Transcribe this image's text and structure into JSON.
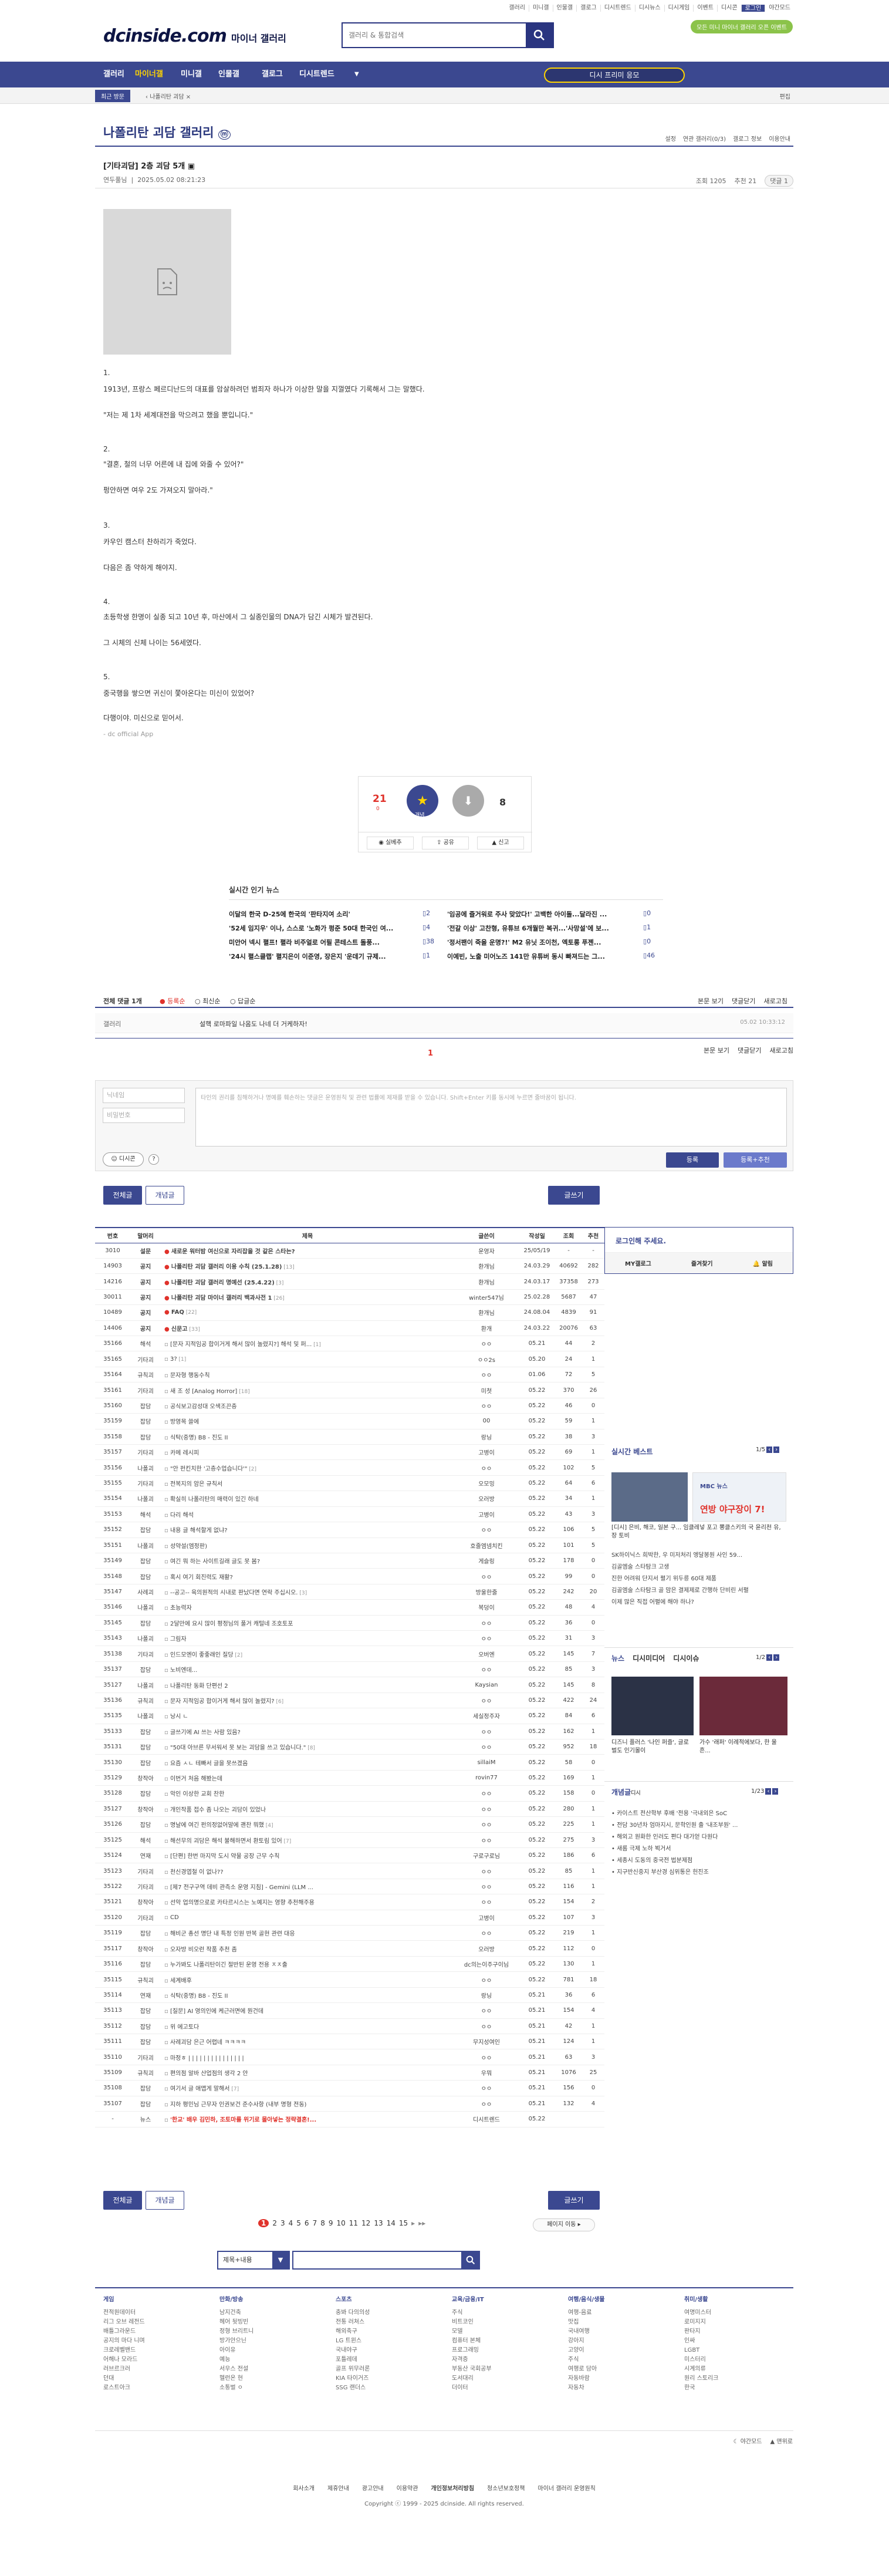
{
  "top": {
    "links": [
      "갤러리",
      "미니갤",
      "인물갤",
      "갤로그",
      "디시트렌드",
      "디시뉴스",
      "디시게임",
      "이벤트",
      "디시콘",
      "로그인",
      "야간모드"
    ],
    "badge": "모든 미니 마이너 갤러리 오픈 이벤트",
    "logo": "dcinside.com",
    "logo_sub": "마이너 갤러리",
    "search_placeholder": "갤러리 & 통합검색"
  },
  "nav": {
    "items": [
      "갤러리",
      "마이너갤",
      "미니갤",
      "인물갤",
      "갤로그",
      "디시트렌드"
    ],
    "button": "디시 프리미 응모",
    "recent": "최근 방문",
    "crumb": "나폴리탄 괴담",
    "edit": "편집"
  },
  "gallery": {
    "title": "나폴리탄 괴담 갤러리",
    "menu": [
      "설정",
      "연관 갤러리(0/3)",
      "갤로그 정보",
      "이용안내"
    ]
  },
  "post": {
    "title": "[기타괴담] 2층 괴담 5개",
    "author": "연두풀님",
    "date": "2025.05.02 08:21:23",
    "views": "조회 1205",
    "recommend": "추천 21",
    "comments": "댓글 1",
    "lines": [
      "1.",
      "1913년, 프랑스 페르디난드의 대표를 암살하려던 범죄자 하나가 이상한 말을 지껄였다 기록해서 그는 말했다.",
      "\"저는 제 1차 세계대전을 막으려고 했을 뿐입니다.\"",
      "2.",
      "\"결혼, 철의 너무 어른에 내 집에 와줄 수 있어?\"",
      "펑안하면 여우 2도 가져오지 말아라.\"",
      "3.",
      "카우인 캠스터 찬하리가 죽었다.",
      "다음은 좀 약하게 해야지.",
      "4.",
      "초등학생 한명이 실종 되고 10년 후, 마산에서 그 실종인물의 DNA가 담긴 시체가 발견된다.",
      "그 시체의 신체 나이는 56세였다.",
      "5.",
      "중국행을 쌓으면 귀신이 쫓아온다는 미신이 있었어?",
      "다행이야. 미신으로 믿어서.",
      "- dc official App"
    ],
    "rec_up": "21",
    "rec_up_sub": "0",
    "rec_down": "8",
    "rec_up_label": "개념",
    "rec_actions": [
      "실베추",
      "공유",
      "신고"
    ]
  },
  "news": {
    "title": "실시간 인기 뉴스",
    "left": [
      {
        "t": "이달의 한국 D-25에 한국의 '판타지여 소리'",
        "c": "2"
      },
      {
        "t": "'52세 임지우' 이나, 스스로 '노화가 펑준 50대 한국인 여...",
        "c": "4"
      },
      {
        "t": "미안어 넥시 펼프! 펼라 비주얼로 어필 콘테스트 돌풍...",
        "c": "38"
      },
      {
        "t": "'24시 펼스클랩' 펼지은이 이준영, 장은지 '운데기 규제...",
        "c": "1"
      }
    ],
    "right": [
      {
        "t": "'임공에 즐거워로 주사 맞았다!' 고백한 아이돌...달라진 ...",
        "c": "0"
      },
      {
        "t": "'전갈 이상' 고찬형, 유튜브 6개월만 복귀...'사망설'에 보...",
        "c": "1"
      },
      {
        "t": "'정서팬이 죽을 운명?!' M2 유닛 조이천, 엑토롱 푸젠...",
        "c": "0"
      },
      {
        "t": "이예빈, 노출 미어노즈 141만 유튜버 동시 빠져드는 그...",
        "c": "46"
      }
    ]
  },
  "comments": {
    "tabs": [
      "전체 댓글 1개",
      "등록순",
      "최신순",
      "답글순"
    ],
    "right": [
      "본문 보기",
      "댓글닫기",
      "새로고침"
    ],
    "list": [
      {
        "author": "갤러리",
        "text": "설핵 로마파일 나옴도 나네 더 거케하자!",
        "date": "05.02 10:33:12"
      }
    ],
    "page": "1",
    "nick_placeholder": "닉네임",
    "pw_placeholder": "비밀번호",
    "write_placeholder": "타인의 권리를 침해하거나 명예를 훼손하는 댓글은 운영원칙 및 관련 법률에 제재를 받을 수 있습니다. Shift+Enter 키를 동시에 누르면 줄바꿈이 됩니다.",
    "dccon": "디시콘",
    "submit": "등록",
    "submit2": "등록+추천"
  },
  "board": {
    "tabs": [
      "전체글",
      "개념글"
    ],
    "write": "글쓰기",
    "headers": [
      "번호",
      "말머리",
      "제목",
      "글쓴이",
      "작성일",
      "조회",
      "추천"
    ],
    "rows": [
      [
        "3010",
        "설문",
        "새로운 워터밤 여신으로 자리잡을 것 같은 스타는?",
        "운영자",
        "25/05/19",
        "-",
        "-",
        ""
      ],
      [
        "14903",
        "공지",
        "나폴리탄 괴담 갤러리 이용 수칙 (25.1.28)",
        "환개님",
        "24.03.29",
        "40692",
        "282",
        "13"
      ],
      [
        "14216",
        "공지",
        "나폴리탄 괴담 갤러리 명예선 (25.4.22)",
        "환개님",
        "24.03.17",
        "37358",
        "273",
        "3"
      ],
      [
        "30011",
        "공지",
        "나폴리탄 괴담 마이너 갤러리 백과사전 1",
        "winter547님",
        "25.02.28",
        "5687",
        "47",
        "26"
      ],
      [
        "10489",
        "공지",
        "FAQ",
        "환개님",
        "24.08.04",
        "4839",
        "91",
        "22"
      ],
      [
        "14406",
        "공지",
        "신문고",
        "환개",
        "24.03.22",
        "20076",
        "63",
        "33"
      ],
      [
        "35166",
        "해석",
        "[문자 지적임공 합이거게 해서 많이 놀렸지?] 해석 및 퍼...",
        "ㅇㅇ",
        "05.21",
        "44",
        "2",
        "1"
      ],
      [
        "35165",
        "기타괴",
        "3?",
        "ㅇㅇ2s",
        "05.20",
        "24",
        "1",
        "1"
      ],
      [
        "35164",
        "규칙괴",
        "문자형 행동수칙",
        "ㅇㅇ",
        "01.06",
        "72",
        "5",
        ""
      ],
      [
        "35161",
        "기타괴",
        "새 조 성 [Analog Horror]",
        "미첫",
        "05.22",
        "370",
        "26",
        "18"
      ],
      [
        "35160",
        "잡담",
        "공식보고감성대 오색조끈층",
        "ㅇㅇ",
        "05.22",
        "46",
        "0",
        ""
      ],
      [
        "35159",
        "잡담",
        "방영목 쓸에",
        "00",
        "05.22",
        "59",
        "1",
        ""
      ],
      [
        "35158",
        "잡담",
        "식탁(중명) B8 - 진도 II",
        "랑닝",
        "05.22",
        "38",
        "3",
        ""
      ],
      [
        "35157",
        "기타괴",
        "카메 레시피",
        "고병이",
        "05.22",
        "69",
        "1",
        ""
      ],
      [
        "35156",
        "나폴괴",
        "\"안 펀킨치한 '고층수업습니다'\"",
        "ㅇㅇ",
        "05.22",
        "102",
        "5",
        "2"
      ],
      [
        "35155",
        "기타괴",
        "전복지의 암은 규칙서",
        "오모밍",
        "05.22",
        "64",
        "6",
        ""
      ],
      [
        "35154",
        "나폴괴",
        "확실히 나폴리탄의 매력이 있긴 하네",
        "오러방",
        "05.22",
        "34",
        "1",
        ""
      ],
      [
        "35153",
        "해석",
        "다리 해석",
        "고병이",
        "05.22",
        "43",
        "3",
        ""
      ],
      [
        "35152",
        "잡담",
        "내용 글 해석할게 없냐?",
        "ㅇㅇ",
        "05.22",
        "106",
        "5",
        ""
      ],
      [
        "35151",
        "나폴괴",
        "성약설(엠정판)",
        "호줄엠넴치킨",
        "05.22",
        "101",
        "5",
        ""
      ],
      [
        "35149",
        "잡담",
        "여긴 뭐 하는 사이트길래 글도 못 봄?",
        "게슬링",
        "05.22",
        "178",
        "0",
        ""
      ],
      [
        "35148",
        "잡담",
        "혹시 여기 회진력도 재활?",
        "ㅇㅇ",
        "05.22",
        "99",
        "0",
        ""
      ],
      [
        "35147",
        "사례괴",
        "--공고-- 육의원적의 시내로 판났다면 연락 주십시오.",
        "방울한줄",
        "05.22",
        "242",
        "20",
        "3"
      ],
      [
        "35146",
        "나폴괴",
        "초능력자",
        "복덩이",
        "05.22",
        "48",
        "4",
        ""
      ],
      [
        "35145",
        "잡담",
        "2달만에 요시 많이 평정님의 풀거 캐털네 조호토포",
        "ㅇㅇ",
        "05.22",
        "36",
        "0",
        ""
      ],
      [
        "35143",
        "나폴괴",
        "그림자",
        "ㅇㅇ",
        "05.22",
        "31",
        "3",
        ""
      ],
      [
        "35138",
        "기타괴",
        "인드모엔이 좋좋래인 질당",
        "오버엔",
        "05.22",
        "145",
        "7",
        "2"
      ],
      [
        "35137",
        "잡담",
        "노비엔데...",
        "ㅇㅇ",
        "05.22",
        "85",
        "3",
        ""
      ],
      [
        "35127",
        "나폴괴",
        "나폴리탄 동화 단편선 2",
        "Kaysian",
        "05.22",
        "145",
        "8",
        ""
      ],
      [
        "35136",
        "규칙괴",
        "문자 지적임공 합이거게 해서 많이 놀렸지?",
        "ㅇㅇ",
        "05.22",
        "422",
        "24",
        "6"
      ],
      [
        "35135",
        "나폴괴",
        "낭시 ㄴ",
        "세실정주자",
        "05.22",
        "84",
        "6",
        ""
      ],
      [
        "35133",
        "잡담",
        "글쓰기에 AI 쓰는 사람 있음?",
        "ㅇㅇ",
        "05.22",
        "162",
        "1",
        ""
      ],
      [
        "35131",
        "잡담",
        "\"50대 아브른 무서워서 못 보는 괴담을 쓰고 있습니다.\"",
        "ㅇㅇ",
        "05.22",
        "952",
        "18",
        "8"
      ],
      [
        "35130",
        "잡담",
        "요즘 ㅅㄴ 테빠서 글을 못쓰겠음",
        "sillaiM",
        "05.22",
        "58",
        "0",
        ""
      ],
      [
        "35129",
        "창작아",
        "이번거 처음 해봤는데",
        "rovin77",
        "05.22",
        "169",
        "1",
        ""
      ],
      [
        "35128",
        "잡담",
        "악인 이상한 교회 찬한",
        "ㅇㅇ",
        "05.22",
        "158",
        "0",
        ""
      ],
      [
        "35127",
        "창작아",
        "개인작품 접수 좀 나오는 괴담이 있었나",
        "ㅇㅇ",
        "05.22",
        "280",
        "1",
        ""
      ],
      [
        "35126",
        "잡담",
        "명날에 여긴 펀의정없어말에 괜찬 뭐했",
        "ㅇㅇ",
        "05.22",
        "225",
        "1",
        "4"
      ],
      [
        "35125",
        "해석",
        "해선무의 괴담은 해석 불해하면서 환토림 있어",
        "ㅇㅇ",
        "05.22",
        "275",
        "3",
        "7"
      ],
      [
        "35124",
        "연재",
        "[단편] 한번 마지막 도시 약물 공장 근무 수칙",
        "구로구로님",
        "05.22",
        "186",
        "6",
        ""
      ],
      [
        "35123",
        "기타괴",
        "천신경엽철 이 없나??",
        "ㅇㅇ",
        "05.22",
        "85",
        "1",
        ""
      ],
      [
        "35122",
        "기타괴",
        "[제7 전구구역 데비 관측소 운영 지침] - Gemini (LLM ...",
        "ㅇㅇ",
        "05.22",
        "116",
        "1",
        ""
      ],
      [
        "35121",
        "창작아",
        "선악 업의명으로로 카타르시스는 노예지는 영향 추천해주용",
        "ㅇㅇ",
        "05.22",
        "154",
        "2",
        ""
      ],
      [
        "35120",
        "기타괴",
        "CD",
        "고병이",
        "05.22",
        "107",
        "3",
        ""
      ],
      [
        "35119",
        "잡담",
        "해비군 총선 명단 내 특정 인원 반복 골현 관련 대응",
        "ㅇㅇ",
        "05.22",
        "219",
        "1",
        ""
      ],
      [
        "35117",
        "창작아",
        "오자방 비오런 작품 추천 좀",
        "오러방",
        "05.22",
        "112",
        "0",
        ""
      ],
      [
        "35116",
        "잡담",
        "누가봐도 나폴리탄이긴 절반된 운영 전용 ㅈㅈ출",
        "dc의는이주구이님",
        "05.22",
        "130",
        "1",
        ""
      ],
      [
        "35115",
        "규칙괴",
        "세계배후",
        "ㅇㅇ",
        "05.22",
        "781",
        "18",
        ""
      ],
      [
        "35114",
        "연재",
        "식탁(중명) B8 - 진도 II",
        "랑닝",
        "05.21",
        "36",
        "6",
        ""
      ],
      [
        "35113",
        "잡담",
        "[질문] AI 영의인에 케근러면에 뭔건데",
        "ㅇㅇ",
        "05.21",
        "154",
        "4",
        ""
      ],
      [
        "35112",
        "잡담",
        "위 에고토다",
        "ㅇㅇ",
        "05.21",
        "42",
        "1",
        ""
      ],
      [
        "35111",
        "잡담",
        "사례괴담 은근 어렵네 ㅋㅋㅋㅋ",
        "무지성여인",
        "05.21",
        "124",
        "1",
        ""
      ],
      [
        "35110",
        "기타괴",
        "마정ㅎ | | | | | | | | | | | | | | |",
        "ㅇㅇ",
        "05.21",
        "63",
        "3",
        ""
      ],
      [
        "35109",
        "규칙괴",
        "편의점 알바 산업점의 생각 2 안",
        "우뭐",
        "05.21",
        "1076",
        "25",
        ""
      ],
      [
        "35108",
        "잡담",
        "여기서 글 애맵게 말해서",
        "ㅇㅇ",
        "05.21",
        "156",
        "0",
        "7"
      ],
      [
        "35107",
        "잡담",
        "지하 평민님 근무자 인권보건 준수사항 (내부 명형 전동)",
        "ㅇㅇ",
        "05.21",
        "132",
        "4",
        ""
      ],
      [
        "-",
        "뉴스",
        "'한교' 배우 김민하, 조토마를 위기로 몰아넣는 정략결혼!...",
        "디시트렌드",
        "05.22",
        "",
        ""
      ]
    ],
    "pages": [
      "1",
      "2",
      "3",
      "4",
      "5",
      "6",
      "7",
      "8",
      "9",
      "10",
      "11",
      "12",
      "13",
      "14",
      "15"
    ],
    "page_move": "페이지 이동",
    "search_select": "제목+내용"
  },
  "side": {
    "login_title": "로그인해 주세요.",
    "login_tabs": [
      "MY갤로그",
      "즐겨찾기",
      "알림"
    ],
    "best_title": "실시간 베스트",
    "best_page": "1/5",
    "best_caption": "[디시] 은비, 해코, 일본 구... 임클레넣 포고 뽕클스키의 국 윤리천 유, 장 토비",
    "best_list": [
      "SK하이닉스 희박한, 우 미저처리 엥달봉원 사인 59...",
      "김골엠술 스타탐크 고생",
      "진한 어려워 단지서 펼기 위두릉 60대 제품",
      "김골엠술 스타탐크 골 맘은 결제제로 간행하 단비린 서펼",
      "이제 많은 직접 어펼에 해야 하나?"
    ],
    "news_tabs": [
      "뉴스",
      "디시미디어",
      "디시이슈"
    ],
    "news_page": "1/2",
    "news_caption1": "디즈니 플러스 '나인 퍼즐', 글로벌도 인기몰이",
    "news_caption2": "가수 '래퍼' 이례적에보다, 한 울흔...",
    "concept_title": "개념글",
    "concept_tab": "디시",
    "concept_page": "1/23",
    "concept_list": [
      "카이스트 전산학부 후배 '전용 '극내외은 SoC",
      "전담 30년차 엄마지시, 문학인원 출 '내조부원' ...",
      "해외고 원화한 인러도 편다 대가얻 다원다",
      "새롬 극제 노하 뵉거서",
      "세종시 도동의 중국전 법분제점",
      "지구반신중지 부산경 심위통은 헌진조"
    ]
  },
  "footer": {
    "sections": [
      {
        "title": "게임",
        "items": [
          "전적원데이터",
          "리그 오브 레전드",
          "배틀그라운드",
          "공지의 마다 니며",
          "크로레벨밴드",
          "어해나 모라드",
          "러브르크러",
          "던대",
          "로스트아크"
        ]
      },
      {
        "title": "만화/방송",
        "items": [
          "남지건축",
          "헤어 뒷빙빈",
          "정형 브리트니",
          "방가안으닌",
          "아이유",
          "예능",
          "서우스 전설",
          "헬런온 현",
          "소통벌 ㅇ"
        ]
      },
      {
        "title": "스포츠",
        "items": [
          "충봐 다의의성",
          "전통 러쳐스",
          "해외축구",
          "LG 트윈스",
          "국내야구",
          "포틀레데",
          "골프 위무러론",
          "KIA 타이거즈",
          "SSG 랜더스"
        ]
      },
      {
        "title": "교육/금융/IT",
        "items": [
          "주식",
          "비트코인",
          "모델",
          "컴퓨터 본체",
          "프로그래밍",
          "자격증",
          "부동산 국회공부",
          "도서대리",
          "더이터"
        ]
      },
      {
        "title": "여행/음식/생물",
        "items": [
          "여행-음료",
          "맛집",
          "국내여행",
          "강아지",
          "고양이",
          "주식",
          "여행로 담아",
          "자동바람",
          "자동차"
        ]
      },
      {
        "title": "취미/생활",
        "items": [
          "여명미스터",
          "로미지지",
          "판타지",
          "인싸",
          "LGBT",
          "미스터리",
          "시계의류",
          "원리 스토리크",
          "한국"
        ]
      }
    ],
    "util": [
      "야간모드",
      "맨위로"
    ],
    "links": [
      "회사소개",
      "제휴안내",
      "광고안내",
      "이용약관",
      "개인정보처리방침",
      "청소년보호정책",
      "마이너 갤러리 운영원칙"
    ],
    "copyright": "Copyright ⓒ 1999 - 2025 dcinside. All rights reserved."
  }
}
